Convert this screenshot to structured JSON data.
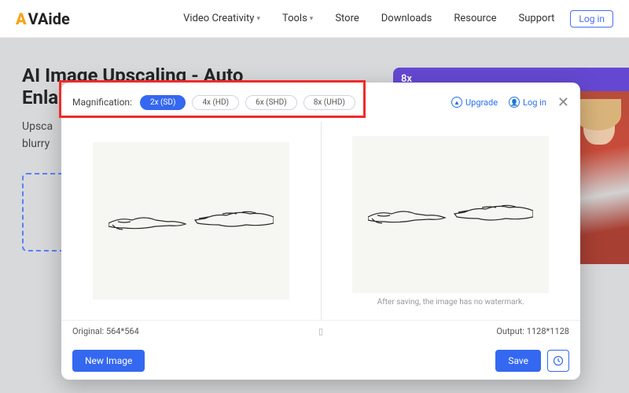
{
  "brand": "VAide",
  "nav": {
    "items": [
      "Video Creativity",
      "Tools",
      "Store",
      "Downloads",
      "Resource",
      "Support"
    ],
    "login": "Log in"
  },
  "page": {
    "title_line1": "AI Image Upscaling - Auto",
    "title_line2": "Enla",
    "sub_line1": "Upsca",
    "sub_line2": "blurry",
    "banner_badge": "8x"
  },
  "modal": {
    "mag_label": "Magnification:",
    "options": [
      "2x (SD)",
      "4x (HD)",
      "6x (SHD)",
      "8x (UHD)"
    ],
    "active_index": 0,
    "upgrade": "Upgrade",
    "login": "Log in",
    "watermark_note": "After saving, the image has no watermark.",
    "original_label": "Original: 564*564",
    "output_label": "Output: 1128*1128",
    "new_image": "New Image",
    "save": "Save"
  }
}
